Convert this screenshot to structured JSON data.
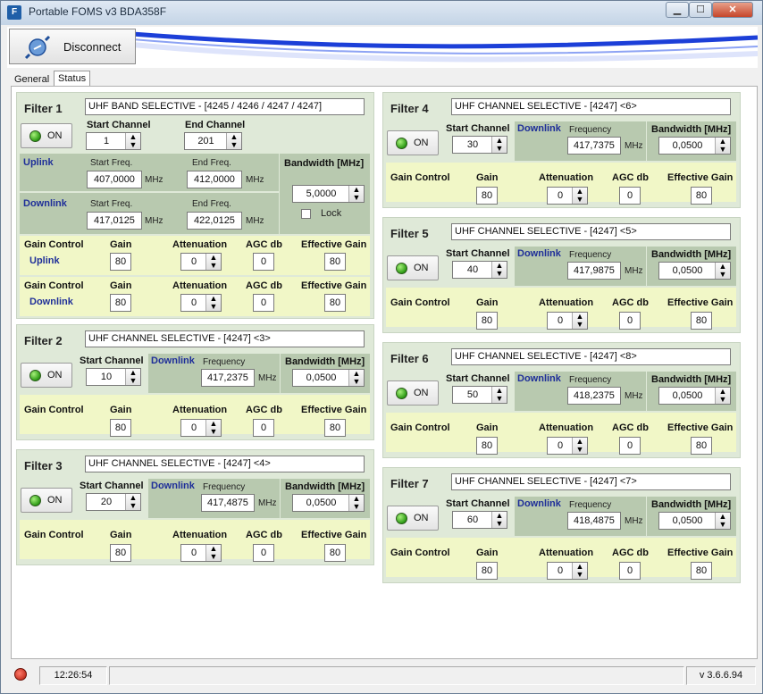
{
  "window": {
    "title": "Portable FOMS v3 BDA358F",
    "icon": "app-icon",
    "min": "minimize-icon",
    "max": "maximize-icon",
    "close": "close-icon"
  },
  "toolbar": {
    "disconnect_label": "Disconnect",
    "plug_icon": "plug-icon"
  },
  "tabs": [
    {
      "label": "General"
    },
    {
      "label": "Status"
    }
  ],
  "labels": {
    "on": "ON",
    "start_channel": "Start Channel",
    "end_channel": "End Channel",
    "uplink": "Uplink",
    "downlink": "Downlink",
    "start_freq": "Start Freq.",
    "end_freq": "End Freq.",
    "mhz": "MHz",
    "bandwidth": "Bandwidth [MHz]",
    "lock": "Lock",
    "frequency": "Frequency",
    "gain_control": "Gain Control",
    "gain": "Gain",
    "attenuation": "Attenuation",
    "agc_db": "AGC db",
    "effective_gain": "Effective Gain"
  },
  "filter1": {
    "name": "Filter 1",
    "description": "UHF BAND SELECTIVE - [4245 / 4246 / 4247 / 4247]",
    "start_channel": "1",
    "end_channel": "201",
    "uplink": {
      "start_freq": "407,0000",
      "end_freq": "412,0000"
    },
    "downlink": {
      "start_freq": "417,0125",
      "end_freq": "422,0125"
    },
    "bandwidth": "5,0000",
    "lock": false,
    "gain_uplink": {
      "gain": "80",
      "attenuation": "0",
      "agc": "0",
      "effective": "80"
    },
    "gain_downlink": {
      "gain": "80",
      "attenuation": "0",
      "agc": "0",
      "effective": "80"
    }
  },
  "filters": [
    {
      "name": "Filter 2",
      "description": "UHF CHANNEL SELECTIVE - [4247] <3>",
      "start_channel": "10",
      "frequency": "417,2375",
      "bandwidth": "0,0500",
      "gain": "80",
      "attenuation": "0",
      "agc": "0",
      "effective": "80"
    },
    {
      "name": "Filter 3",
      "description": "UHF CHANNEL SELECTIVE - [4247] <4>",
      "start_channel": "20",
      "frequency": "417,4875",
      "bandwidth": "0,0500",
      "gain": "80",
      "attenuation": "0",
      "agc": "0",
      "effective": "80"
    },
    {
      "name": "Filter 4",
      "description": "UHF CHANNEL SELECTIVE - [4247] <6>",
      "start_channel": "30",
      "frequency": "417,7375",
      "bandwidth": "0,0500",
      "gain": "80",
      "attenuation": "0",
      "agc": "0",
      "effective": "80"
    },
    {
      "name": "Filter 5",
      "description": "UHF CHANNEL SELECTIVE - [4247] <5>",
      "start_channel": "40",
      "frequency": "417,9875",
      "bandwidth": "0,0500",
      "gain": "80",
      "attenuation": "0",
      "agc": "0",
      "effective": "80"
    },
    {
      "name": "Filter 6",
      "description": "UHF CHANNEL SELECTIVE - [4247] <8>",
      "start_channel": "50",
      "frequency": "418,2375",
      "bandwidth": "0,0500",
      "gain": "80",
      "attenuation": "0",
      "agc": "0",
      "effective": "80"
    },
    {
      "name": "Filter 7",
      "description": "UHF CHANNEL SELECTIVE - [4247] <7>",
      "start_channel": "60",
      "frequency": "418,4875",
      "bandwidth": "0,0500",
      "gain": "80",
      "attenuation": "0",
      "agc": "0",
      "effective": "80"
    }
  ],
  "status": {
    "icon": "stop-icon",
    "time": "12:26:54",
    "message": "",
    "version": "v 3.6.6.94"
  },
  "colors": {
    "panel": "#dfe9d8",
    "zone": "#b8c9af",
    "gain_zone": "#f1f7c7",
    "link_blue": "#1f2f99",
    "led_green": "#2c9a14"
  }
}
